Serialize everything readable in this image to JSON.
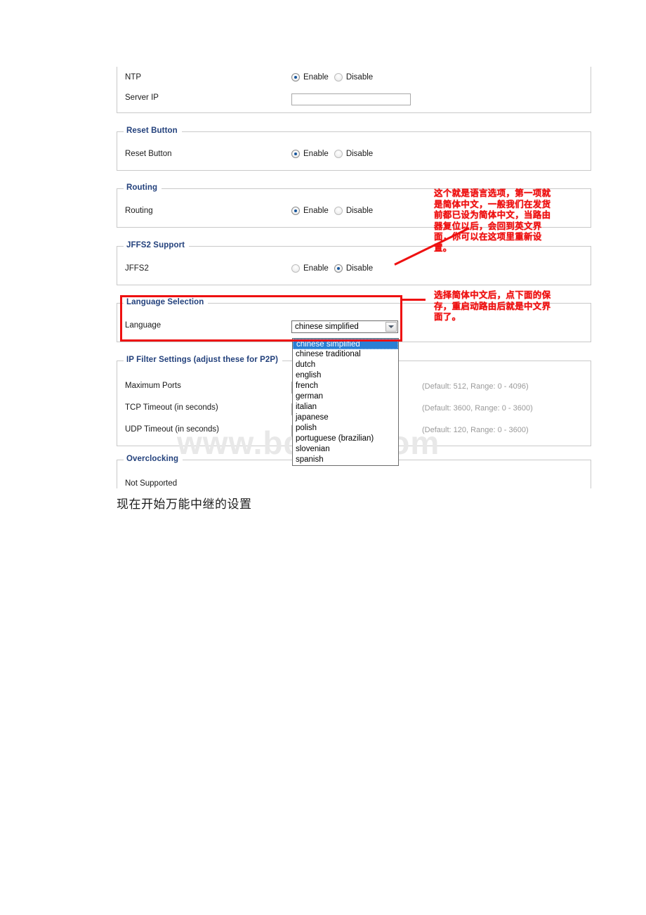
{
  "screenshot": {
    "watermark": "www.bdocx.com",
    "panels": [
      {
        "id": "ntp",
        "legend": "",
        "rows": [
          {
            "label": "NTP",
            "control": "radio",
            "options": [
              "Enable",
              "Disable"
            ],
            "selected": "Enable",
            "hint": ""
          },
          {
            "label": "Server IP",
            "control": "text",
            "value": "",
            "hint": ""
          }
        ]
      },
      {
        "id": "reset-button",
        "legend": "Reset Button",
        "rows": [
          {
            "label": "Reset Button",
            "control": "radio",
            "options": [
              "Enable",
              "Disable"
            ],
            "selected": "Enable",
            "hint": ""
          }
        ]
      },
      {
        "id": "routing",
        "legend": "Routing",
        "rows": [
          {
            "label": "Routing",
            "control": "radio",
            "options": [
              "Enable",
              "Disable"
            ],
            "selected": "Enable",
            "hint": ""
          }
        ]
      },
      {
        "id": "jffs2-support",
        "legend": "JFFS2 Support",
        "rows": [
          {
            "label": "JFFS2",
            "control": "radio",
            "options": [
              "Enable",
              "Disable"
            ],
            "selected": "Disable",
            "hint": ""
          }
        ]
      },
      {
        "id": "language-selection",
        "legend": "Language Selection",
        "rows": [
          {
            "label": "Language",
            "control": "select",
            "value": "chinese simplified",
            "hint": ""
          }
        ]
      },
      {
        "id": "ip-filter-settings",
        "legend": "IP Filter Settings (adjust these for P2P)",
        "rows": [
          {
            "label": "Maximum Ports",
            "control": "text",
            "value": "",
            "hint": "(Default: 512, Range: 0 - 4096)"
          },
          {
            "label": "TCP Timeout (in seconds)",
            "control": "text",
            "value": "",
            "hint": "(Default: 3600, Range: 0 - 3600)"
          },
          {
            "label": "UDP Timeout (in seconds)",
            "control": "text",
            "value": "",
            "hint": "(Default: 120, Range: 0 - 3600)"
          }
        ]
      },
      {
        "id": "overclocking",
        "legend": "Overclocking",
        "rows": [
          {
            "label": "Not Supported",
            "control": "none",
            "value": "",
            "hint": ""
          }
        ]
      }
    ],
    "language_dropdown": {
      "selected": "chinese simplified",
      "options": [
        "chinese simplified",
        "chinese traditional",
        "dutch",
        "english",
        "french",
        "german",
        "italian",
        "japanese",
        "polish",
        "portuguese (brazilian)",
        "slovenian",
        "spanish"
      ]
    },
    "annotations": {
      "note1": "这个就是语言选项，第一项就是简体中文，一般我们在发货前都已设为简体中文，当路由器复位以后，会回到英文界面，你可以在这项里重新设置。",
      "note2": "选择简体中文后，点下面的保存，重启动路由后就是中文界面了。",
      "color": "#ee1111"
    }
  },
  "caption": "现在开始万能中继的设置"
}
